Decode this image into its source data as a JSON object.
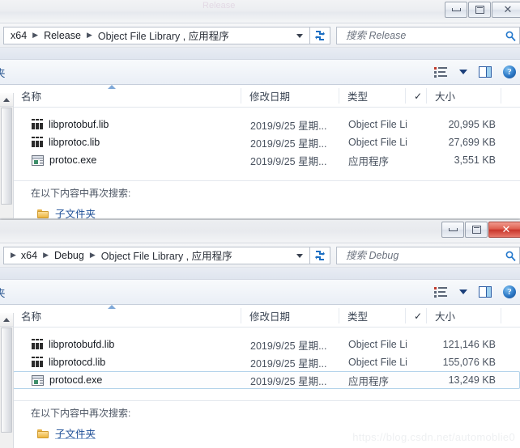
{
  "window_top": {
    "title_watermark": "Release",
    "controls": {
      "minimize": "—",
      "maximize": "□",
      "close": "✕"
    },
    "address_bar": {
      "crumbs": [
        "x64",
        "Release",
        "Object File Library , 应用程序"
      ],
      "dropdown_caret": "▾",
      "refresh_tooltip": "刷新"
    },
    "search": {
      "placeholder": "搜索 Release",
      "value": ""
    },
    "toolbar": {
      "left_label": "夹",
      "view_icon": "view-list-icon",
      "caret": "▾",
      "preview_pane_icon": "preview-pane-icon",
      "help_icon": "?"
    },
    "columns": {
      "name": "名称",
      "date": "修改日期",
      "type": "类型",
      "check": "✓",
      "size": "大小"
    },
    "files": [
      {
        "name": "libprotobuf.lib",
        "date": "2019/9/25 星期...",
        "type": "Object File Library",
        "size": "20,995 KB",
        "icon": "lib-file-icon",
        "selected": false
      },
      {
        "name": "libprotoc.lib",
        "date": "2019/9/25 星期...",
        "type": "Object File Library",
        "size": "27,699 KB",
        "icon": "lib-file-icon",
        "selected": false
      },
      {
        "name": "protoc.exe",
        "date": "2019/9/25 星期...",
        "type": "应用程序",
        "size": "3,551 KB",
        "icon": "exe-file-icon",
        "selected": false
      }
    ],
    "search_again": {
      "label": "在以下内容中再次搜索:",
      "items": [
        "子文件夹"
      ]
    }
  },
  "window_bottom": {
    "controls": {
      "minimize": "—",
      "maximize": "□",
      "close": "✕"
    },
    "address_bar": {
      "crumbs": [
        "x64",
        "Debug",
        "Object File Library , 应用程序"
      ],
      "dropdown_caret": "▾",
      "refresh_tooltip": "刷新"
    },
    "search": {
      "placeholder": "搜索 Debug",
      "value": ""
    },
    "toolbar": {
      "left_label": "夹",
      "view_icon": "view-list-icon",
      "caret": "▾",
      "preview_pane_icon": "preview-pane-icon",
      "help_icon": "?"
    },
    "columns": {
      "name": "名称",
      "date": "修改日期",
      "type": "类型",
      "check": "✓",
      "size": "大小"
    },
    "files": [
      {
        "name": "libprotobufd.lib",
        "date": "2019/9/25 星期...",
        "type": "Object File Library",
        "size": "121,146 KB",
        "icon": "lib-file-icon",
        "selected": false
      },
      {
        "name": "libprotocd.lib",
        "date": "2019/9/25 星期...",
        "type": "Object File Library",
        "size": "155,076 KB",
        "icon": "lib-file-icon",
        "selected": false
      },
      {
        "name": "protocd.exe",
        "date": "2019/9/25 星期...",
        "type": "应用程序",
        "size": "13,249 KB",
        "icon": "exe-file-icon",
        "selected": true
      }
    ],
    "search_again": {
      "label": "在以下内容中再次搜索:",
      "items": [
        "子文件夹"
      ]
    }
  },
  "watermark": "https://blog.csdn.net/automoblie0",
  "colors": {
    "close_red": "#c8352a",
    "link_blue": "#1d4e96",
    "header_text": "#3b4554",
    "selection_border": "#b3d2ea"
  }
}
